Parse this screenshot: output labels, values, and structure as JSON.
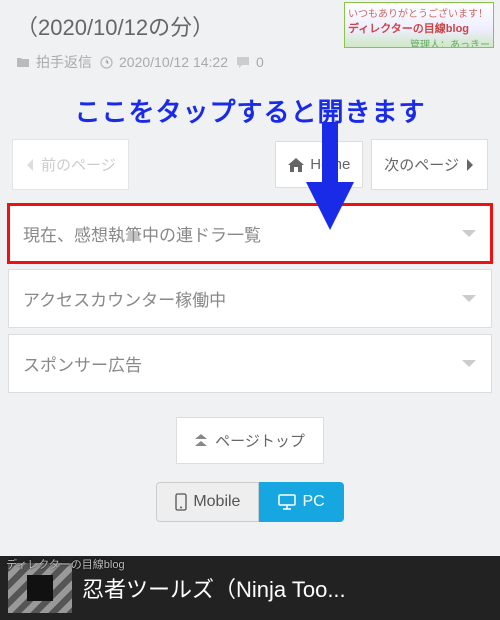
{
  "title": "（2020/10/12の分）",
  "meta": {
    "category": "拍手返信",
    "datetime": "2020/10/12 14:22",
    "comments": "0"
  },
  "cornerAd": {
    "line1": "いつもありがとうございます！",
    "line2": "ディレクターの目線blog",
    "line3": "管理人：あっきー"
  },
  "callout": "ここをタップすると開きます",
  "nav": {
    "prev": "前のページ",
    "home": "Home",
    "next": "次のページ"
  },
  "accordion": [
    {
      "label": "現在、感想執筆中の連ドラ一覧",
      "highlight": true
    },
    {
      "label": "アクセスカウンター稼働中",
      "highlight": false
    },
    {
      "label": "スポンサー広告",
      "highlight": false
    }
  ],
  "pagetop": "ページトップ",
  "mode": {
    "mobile": "Mobile",
    "pc": "PC"
  },
  "footerAd": "忍者ツールズ（Ninja Too...",
  "watermark": "ディレクターの目線blog"
}
